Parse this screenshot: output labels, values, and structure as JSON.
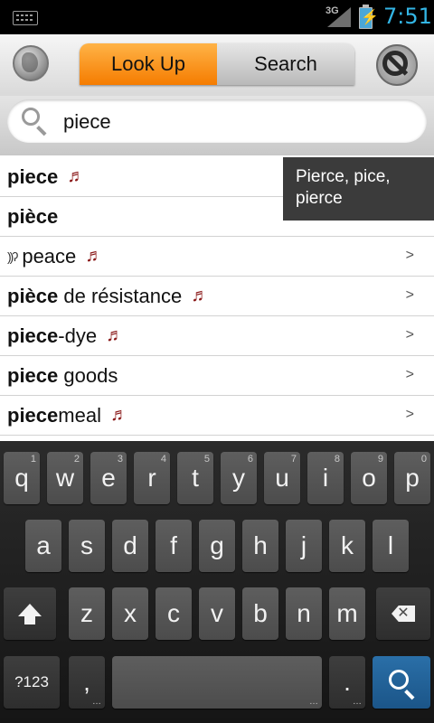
{
  "status_bar": {
    "network": "3G",
    "time": "7:51"
  },
  "header": {
    "tabs": [
      {
        "label": "Look Up",
        "active": true
      },
      {
        "label": "Search",
        "active": false
      }
    ]
  },
  "search": {
    "value": "piece"
  },
  "results": [
    {
      "bold": "piece",
      "rest": "",
      "audio": true,
      "chevron": ""
    },
    {
      "bold": "pièce",
      "rest": "",
      "audio": false,
      "chevron": ""
    },
    {
      "bold": "",
      "rest": "peace",
      "audio": true,
      "chevron": ">",
      "hearing": true
    },
    {
      "bold": "pièce",
      "rest": " de résistance",
      "audio": true,
      "chevron": ">"
    },
    {
      "bold": "piece",
      "rest": "-dye",
      "audio": true,
      "chevron": ">"
    },
    {
      "bold": "piece",
      "rest": " goods",
      "audio": false,
      "chevron": ">"
    },
    {
      "bold": "piece",
      "rest": "meal",
      "audio": true,
      "chevron": ">"
    }
  ],
  "tooltip": {
    "text": "Pierce, pice, pierce"
  },
  "keyboard": {
    "row1": [
      {
        "k": "q",
        "h": "1"
      },
      {
        "k": "w",
        "h": "2"
      },
      {
        "k": "e",
        "h": "3"
      },
      {
        "k": "r",
        "h": "4"
      },
      {
        "k": "t",
        "h": "5"
      },
      {
        "k": "y",
        "h": "6"
      },
      {
        "k": "u",
        "h": "7"
      },
      {
        "k": "i",
        "h": "8"
      },
      {
        "k": "o",
        "h": "9"
      },
      {
        "k": "p",
        "h": "0"
      }
    ],
    "row2": [
      "a",
      "s",
      "d",
      "f",
      "g",
      "h",
      "j",
      "k",
      "l"
    ],
    "row3": [
      "z",
      "x",
      "c",
      "v",
      "b",
      "n",
      "m"
    ],
    "symbols_label": "?123",
    "comma": ",",
    "period": ".",
    "ellipsis": "…"
  },
  "colors": {
    "accent": "#f57c00",
    "clock": "#33b5e5",
    "audio_note": "#8b1a1a",
    "search_key": "#1b5588"
  }
}
